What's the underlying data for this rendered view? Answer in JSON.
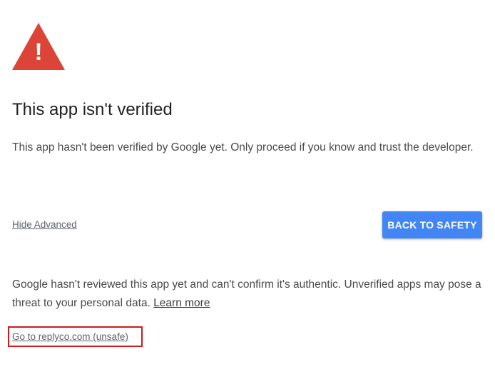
{
  "warning": {
    "icon": "warning-triangle-icon",
    "glyph": "!",
    "color": "#db4437"
  },
  "title": "This app isn't verified",
  "intro": "This app hasn't been verified by Google yet. Only proceed if you know and trust the developer.",
  "hide_advanced_label": "Hide Advanced",
  "back_to_safety_label": "BACK TO SAFETY",
  "advanced": {
    "text": "Google hasn't reviewed this app yet and can't confirm it's authentic. Unverified apps may pose a threat to your personal data.",
    "learn_more_label": "Learn more"
  },
  "proceed_label": "Go to replyco.com (unsafe)",
  "colors": {
    "accent_button": "#4285f4",
    "highlight_border": "#d0191f"
  }
}
